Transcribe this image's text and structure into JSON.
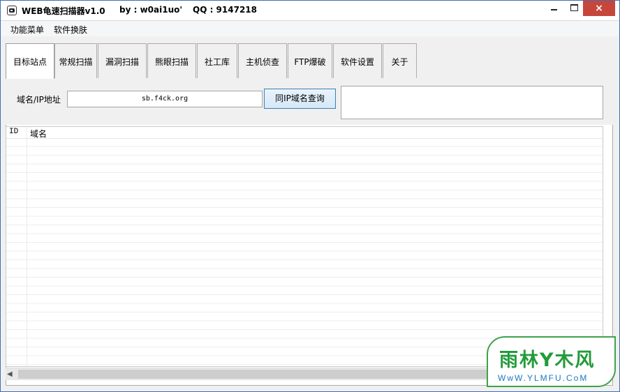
{
  "window": {
    "title": "WEB龟速扫描器v1.0",
    "author": "by : w0ai1uo'",
    "qq": "QQ : 9147218",
    "close_label": "×"
  },
  "menu": {
    "items": [
      {
        "label": "功能菜单"
      },
      {
        "label": "软件换肤"
      }
    ]
  },
  "tabs": [
    {
      "label": "目标站点",
      "active": true
    },
    {
      "label": "常规扫描"
    },
    {
      "label": "漏洞扫描"
    },
    {
      "label": "熊眼扫描"
    },
    {
      "label": "社工库"
    },
    {
      "label": "主机侦查"
    },
    {
      "label": "FTP爆破"
    },
    {
      "label": "软件设置"
    },
    {
      "label": "关于"
    }
  ],
  "target": {
    "domain_label": "域名/IP地址",
    "domain_value": "sb.f4ck.org",
    "query_button": "同IP域名查询"
  },
  "grid": {
    "columns": [
      "ID",
      "域名"
    ],
    "rows": []
  },
  "scrollbar": {
    "left_arrow": "◀"
  },
  "watermark": {
    "title": "雨林Y木风",
    "url": "WwW.YLMFU.CoM"
  }
}
